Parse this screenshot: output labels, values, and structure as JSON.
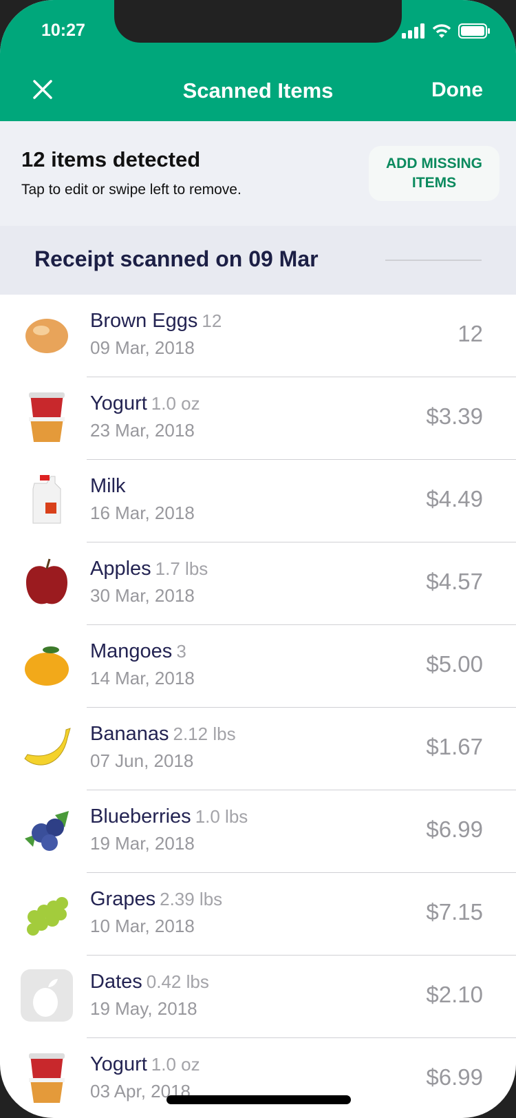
{
  "status_bar": {
    "time": "10:27"
  },
  "header": {
    "title": "Scanned Items",
    "done_label": "Done",
    "close_icon": "close-icon"
  },
  "info": {
    "count_text": "12 items detected",
    "hint": "Tap to edit or swipe left to remove.",
    "add_missing_label": "ADD MISSING ITEMS"
  },
  "receipt": {
    "title": "Receipt scanned on 09 Mar"
  },
  "colors": {
    "brand": "#00a77b",
    "accent_text": "#0b8a5e",
    "name": "#232352",
    "muted": "#98989d"
  },
  "items": [
    {
      "name": "Brown Eggs",
      "qty": "12",
      "date": "09 Mar, 2018",
      "price": "12",
      "icon": "egg"
    },
    {
      "name": "Yogurt",
      "qty": "1.0 oz",
      "date": "23 Mar, 2018",
      "price": "$3.39",
      "icon": "yogurt"
    },
    {
      "name": "Milk",
      "qty": "",
      "date": "16 Mar, 2018",
      "price": "$4.49",
      "icon": "milk"
    },
    {
      "name": "Apples",
      "qty": "1.7 lbs",
      "date": "30 Mar, 2018",
      "price": "$4.57",
      "icon": "apple"
    },
    {
      "name": "Mangoes",
      "qty": "3",
      "date": "14 Mar, 2018",
      "price": "$5.00",
      "icon": "mango"
    },
    {
      "name": "Bananas",
      "qty": "2.12 lbs",
      "date": "07 Jun, 2018",
      "price": "$1.67",
      "icon": "banana"
    },
    {
      "name": "Blueberries",
      "qty": "1.0 lbs",
      "date": "19 Mar, 2018",
      "price": "$6.99",
      "icon": "blueberries"
    },
    {
      "name": "Grapes",
      "qty": "2.39 lbs",
      "date": "10 Mar, 2018",
      "price": "$7.15",
      "icon": "grapes"
    },
    {
      "name": "Dates",
      "qty": "0.42 lbs",
      "date": "19 May, 2018",
      "price": "$2.10",
      "icon": "placeholder-fruit"
    },
    {
      "name": "Yogurt",
      "qty": "1.0 oz",
      "date": "03 Apr, 2018",
      "price": "$6.99",
      "icon": "yogurt"
    }
  ]
}
